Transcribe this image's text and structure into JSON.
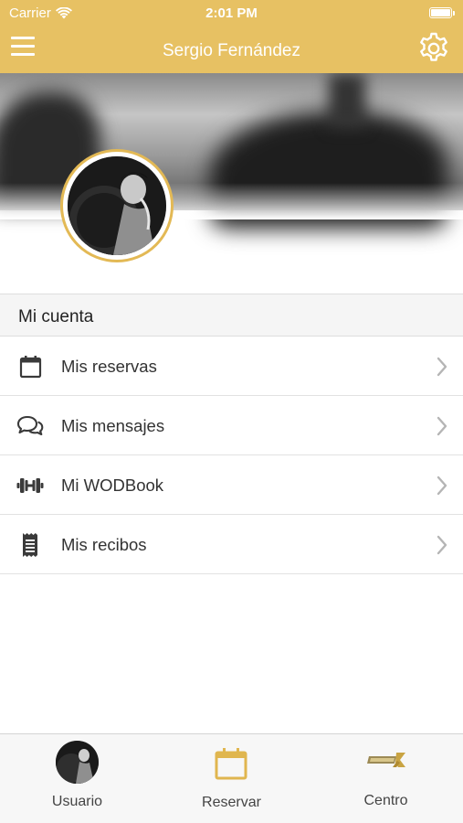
{
  "status_bar": {
    "carrier": "Carrier",
    "time": "2:01 PM"
  },
  "header": {
    "title": "Sergio Fernández",
    "menu_icon": "hamburger-menu-icon",
    "settings_icon": "gear-icon"
  },
  "section": {
    "title": "Mi cuenta"
  },
  "menu_items": [
    {
      "label": "Mis reservas",
      "icon": "calendar-icon"
    },
    {
      "label": "Mis mensajes",
      "icon": "chat-bubbles-icon"
    },
    {
      "label": "Mi WODBook",
      "icon": "dumbbell-icon"
    },
    {
      "label": "Mis recibos",
      "icon": "receipt-icon"
    }
  ],
  "tabbar": {
    "tabs": [
      {
        "label": "Usuario",
        "icon": "user-avatar"
      },
      {
        "label": "Reservar",
        "icon": "calendar-icon"
      },
      {
        "label": "Centro",
        "icon": "center-logo"
      }
    ]
  },
  "colors": {
    "accent": "#e7c163",
    "avatar_ring": "#e3b955",
    "chevron": "#b5b5b5",
    "icon_dark": "#3a3a3a"
  }
}
